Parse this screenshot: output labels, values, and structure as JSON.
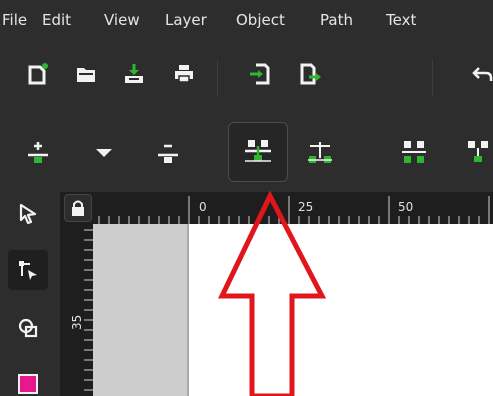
{
  "menu": {
    "items": [
      "File",
      "Edit",
      "View",
      "Layer",
      "Object",
      "Path",
      "Text"
    ]
  },
  "toolbar1": {
    "icons": [
      "new-document-icon",
      "open-folder-icon",
      "import-icon",
      "print-icon",
      "import-file-icon",
      "export-file-icon",
      "undo-icon"
    ]
  },
  "toolbar2": {
    "icons": [
      "snap-add-icon",
      "dropdown-arrow-icon",
      "snap-remove-icon",
      "snap-align-center-icon",
      "snap-align-vertical-icon",
      "snap-distribute-icon",
      "snap-nodes-icon"
    ],
    "active_index": 3
  },
  "rulers": {
    "h_labels": [
      "0",
      "25",
      "50"
    ],
    "v_labels": [
      "35"
    ]
  },
  "tools": {
    "icons": [
      "selector-tool-icon",
      "node-tool-icon",
      "tweak-tool-icon",
      "fill-swatch"
    ]
  },
  "colors": {
    "accent_green": "#2fb52f",
    "swatch_magenta": "#e8178c",
    "annotation_red": "#e0161b",
    "background": "#2d2d2d",
    "ruler": "#1e1e1e"
  }
}
